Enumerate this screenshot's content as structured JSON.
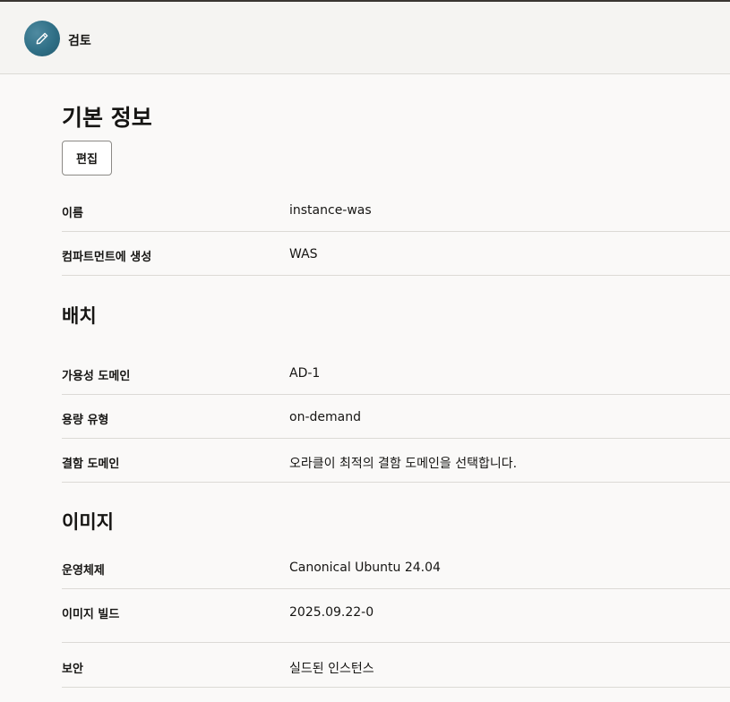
{
  "header": {
    "title": "검토",
    "icon": "pencil-icon"
  },
  "basic": {
    "title": "기본 정보",
    "edit_label": "편집",
    "rows": [
      {
        "label": "이름",
        "value": "instance-was"
      },
      {
        "label": "컴파트먼트에 생성",
        "value": "WAS"
      }
    ]
  },
  "placement": {
    "title": "배치",
    "rows": [
      {
        "label": "가용성 도메인",
        "value": "AD-1"
      },
      {
        "label": "용량 유형",
        "value": "on-demand"
      },
      {
        "label": "결함 도메인",
        "value": "오라클이 최적의 결함 도메인을 선택합니다."
      }
    ]
  },
  "image": {
    "title": "이미지",
    "rows": [
      {
        "label": "운영체제",
        "value": "Canonical Ubuntu 24.04"
      },
      {
        "label": "이미지 빌드",
        "value": "2025.09.22-0"
      },
      {
        "label": "보안",
        "value": "실드된 인스턴스"
      }
    ]
  }
}
